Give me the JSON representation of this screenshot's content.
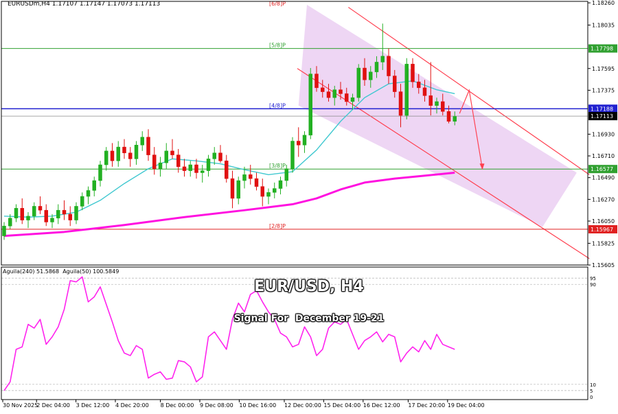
{
  "header": {
    "symbol_info": "EURUSDm,H4",
    "ohlc": "1.17107 1.17147 1.17073 1.17113"
  },
  "overlay": {
    "title": "EUR/USD, H4",
    "subtitle": "Signal For  December 19-21"
  },
  "colors": {
    "bull_candle": "#22b022",
    "bear_candle": "#e01010",
    "sma_fast": "#40c8d0",
    "sma_slow": "#ff10e0",
    "channel_line": "#ff4050",
    "channel_fill": "#e8c8f0",
    "murrey_green": "#30a030",
    "murrey_red": "#e02020",
    "price_blue": "#2020d0",
    "oscillator": "#ff22ee"
  },
  "chart_data": [
    {
      "type": "candlestick",
      "y_axis_ticks": [
        "1.18260",
        "1.18035",
        "1.17595",
        "1.17375",
        "1.16930",
        "1.16710",
        "1.16490",
        "1.16270",
        "1.16050",
        "1.15825",
        "1.15605"
      ],
      "ylim": [
        1.15605,
        1.18275
      ],
      "x_tick_labels": [
        "30 Nov 2025",
        "2 Dec 04:00",
        "3 Dec 12:00",
        "4 Dec 20:00",
        "8 Dec 00:00",
        "9 Dec 08:00",
        "10 Dec 16:00",
        "12 Dec 00:00",
        "15 Dec 04:00",
        "16 Dec 12:00",
        "17 Dec 20:00",
        "19 Dec 04:00"
      ],
      "murrey_levels": [
        {
          "label": "[6/8]P",
          "price": 1.18395,
          "color": "#e02020"
        },
        {
          "label": "[5/8]P",
          "price": 1.17798,
          "color": "#30a030"
        },
        {
          "label": "[4/8]P",
          "price": 1.17188,
          "color": "#2020d0"
        },
        {
          "label": "[3/8]P",
          "price": 1.16577,
          "color": "#30a030"
        },
        {
          "label": "[2/8]P",
          "price": 1.15967,
          "color": "#e02020"
        }
      ],
      "price_tags": [
        {
          "text": "1.17798",
          "price": 1.17798,
          "style": "green"
        },
        {
          "text": "1.17188",
          "price": 1.17188,
          "style": "blue"
        },
        {
          "text": "1.17113",
          "price": 1.17113,
          "style": "dark"
        },
        {
          "text": "1.16577",
          "price": 1.16577,
          "style": "green"
        },
        {
          "text": "1.15967",
          "price": 1.15967,
          "style": "red"
        }
      ],
      "current_price": 1.17113,
      "candles": [
        [
          1.159,
          1.1604,
          1.1586,
          1.16
        ],
        [
          1.16,
          1.1612,
          1.1597,
          1.1608
        ],
        [
          1.1608,
          1.1622,
          1.1604,
          1.1618
        ],
        [
          1.1618,
          1.1628,
          1.1602,
          1.1606
        ],
        [
          1.1606,
          1.1614,
          1.1598,
          1.161
        ],
        [
          1.161,
          1.1624,
          1.1606,
          1.162
        ],
        [
          1.162,
          1.163,
          1.1612,
          1.1616
        ],
        [
          1.1616,
          1.1622,
          1.16,
          1.1604
        ],
        [
          1.1604,
          1.1612,
          1.1598,
          1.1608
        ],
        [
          1.1608,
          1.1622,
          1.1602,
          1.1616
        ],
        [
          1.1616,
          1.1626,
          1.1606,
          1.1612
        ],
        [
          1.1612,
          1.162,
          1.16,
          1.1606
        ],
        [
          1.1606,
          1.1624,
          1.1602,
          1.162
        ],
        [
          1.162,
          1.1634,
          1.1616,
          1.163
        ],
        [
          1.163,
          1.164,
          1.1622,
          1.1636
        ],
        [
          1.1636,
          1.165,
          1.163,
          1.1646
        ],
        [
          1.1646,
          1.1666,
          1.164,
          1.1662
        ],
        [
          1.1662,
          1.168,
          1.1656,
          1.1676
        ],
        [
          1.1676,
          1.1684,
          1.166,
          1.1666
        ],
        [
          1.1666,
          1.1686,
          1.166,
          1.168
        ],
        [
          1.168,
          1.1688,
          1.1668,
          1.1674
        ],
        [
          1.1674,
          1.168,
          1.166,
          1.1668
        ],
        [
          1.1668,
          1.1686,
          1.1662,
          1.1682
        ],
        [
          1.1682,
          1.1696,
          1.1676,
          1.169
        ],
        [
          1.169,
          1.1698,
          1.1666,
          1.1672
        ],
        [
          1.1672,
          1.168,
          1.1652,
          1.1658
        ],
        [
          1.1658,
          1.167,
          1.165,
          1.1664
        ],
        [
          1.1664,
          1.1684,
          1.1658,
          1.1676
        ],
        [
          1.1676,
          1.1688,
          1.1668,
          1.1672
        ],
        [
          1.1672,
          1.1678,
          1.1654,
          1.166
        ],
        [
          1.166,
          1.1668,
          1.165,
          1.1656
        ],
        [
          1.1656,
          1.1666,
          1.165,
          1.1662
        ],
        [
          1.1662,
          1.1668,
          1.1648,
          1.1654
        ],
        [
          1.1654,
          1.1662,
          1.1644,
          1.1656
        ],
        [
          1.1656,
          1.1672,
          1.165,
          1.1668
        ],
        [
          1.1668,
          1.168,
          1.1662,
          1.1674
        ],
        [
          1.1674,
          1.1682,
          1.1664,
          1.1666
        ],
        [
          1.1666,
          1.1672,
          1.1644,
          1.1648
        ],
        [
          1.1648,
          1.1656,
          1.1618,
          1.1628
        ],
        [
          1.1628,
          1.165,
          1.1622,
          1.1646
        ],
        [
          1.1646,
          1.166,
          1.1638,
          1.1652
        ],
        [
          1.1652,
          1.1662,
          1.1642,
          1.1648
        ],
        [
          1.1648,
          1.1654,
          1.1636,
          1.164
        ],
        [
          1.164,
          1.1648,
          1.162,
          1.163
        ],
        [
          1.163,
          1.1638,
          1.1622,
          1.1634
        ],
        [
          1.1634,
          1.1644,
          1.1628,
          1.1638
        ],
        [
          1.1638,
          1.165,
          1.1632,
          1.1646
        ],
        [
          1.1646,
          1.1662,
          1.164,
          1.1658
        ],
        [
          1.1658,
          1.169,
          1.1654,
          1.1686
        ],
        [
          1.1686,
          1.17,
          1.167,
          1.1682
        ],
        [
          1.1682,
          1.1696,
          1.1674,
          1.1692
        ],
        [
          1.1692,
          1.176,
          1.1688,
          1.1754
        ],
        [
          1.1754,
          1.1762,
          1.1736,
          1.174
        ],
        [
          1.174,
          1.1748,
          1.173,
          1.1736
        ],
        [
          1.1736,
          1.1744,
          1.1726,
          1.173
        ],
        [
          1.173,
          1.1742,
          1.1722,
          1.1738
        ],
        [
          1.1738,
          1.1746,
          1.1728,
          1.1734
        ],
        [
          1.1734,
          1.174,
          1.1722,
          1.1726
        ],
        [
          1.1726,
          1.1734,
          1.1718,
          1.173
        ],
        [
          1.173,
          1.1764,
          1.1726,
          1.176
        ],
        [
          1.176,
          1.177,
          1.1742,
          1.1748
        ],
        [
          1.1748,
          1.1762,
          1.174,
          1.1756
        ],
        [
          1.1756,
          1.1772,
          1.175,
          1.1766
        ],
        [
          1.1766,
          1.1805,
          1.1758,
          1.1772
        ],
        [
          1.1772,
          1.178,
          1.1744,
          1.1752
        ],
        [
          1.1752,
          1.1758,
          1.173,
          1.1736
        ],
        [
          1.1736,
          1.1744,
          1.17,
          1.1712
        ],
        [
          1.1712,
          1.177,
          1.1708,
          1.1764
        ],
        [
          1.1764,
          1.177,
          1.174,
          1.1746
        ],
        [
          1.1746,
          1.1754,
          1.1734,
          1.174
        ],
        [
          1.174,
          1.1748,
          1.1726,
          1.1732
        ],
        [
          1.1732,
          1.1766,
          1.1712,
          1.1722
        ],
        [
          1.1722,
          1.173,
          1.1714,
          1.1726
        ],
        [
          1.1726,
          1.1734,
          1.1712,
          1.1716
        ],
        [
          1.1716,
          1.1722,
          1.1704,
          1.1706
        ],
        [
          1.1706,
          1.1716,
          1.1702,
          1.1711
        ]
      ],
      "sma_fast": [
        [
          0,
          1.161
        ],
        [
          4,
          1.1609
        ],
        [
          8,
          1.161
        ],
        [
          12,
          1.1614
        ],
        [
          16,
          1.1626
        ],
        [
          20,
          1.1643
        ],
        [
          24,
          1.1658
        ],
        [
          28,
          1.1668
        ],
        [
          32,
          1.1666
        ],
        [
          36,
          1.1663
        ],
        [
          40,
          1.1657
        ],
        [
          44,
          1.1652
        ],
        [
          48,
          1.1655
        ],
        [
          52,
          1.1677
        ],
        [
          56,
          1.1706
        ],
        [
          60,
          1.173
        ],
        [
          64,
          1.1744
        ],
        [
          68,
          1.1747
        ],
        [
          72,
          1.1738
        ],
        [
          75,
          1.1734
        ]
      ],
      "sma_slow": [
        [
          0,
          1.159
        ],
        [
          10,
          1.1594
        ],
        [
          20,
          1.1601
        ],
        [
          30,
          1.1609
        ],
        [
          40,
          1.1616
        ],
        [
          48,
          1.1622
        ],
        [
          52,
          1.1628
        ],
        [
          56,
          1.1637
        ],
        [
          60,
          1.1644
        ],
        [
          65,
          1.1648
        ],
        [
          70,
          1.1651
        ],
        [
          75,
          1.1654
        ]
      ]
    },
    {
      "type": "line",
      "legend": "Aguila(240) 51.5868  Aguila(50) 100.5849",
      "ylim": [
        0,
        100
      ],
      "levels": [
        95,
        90,
        10,
        5
      ],
      "tick_labels": [
        "95",
        "90",
        "10",
        "5",
        "0"
      ],
      "values": [
        5,
        12,
        38,
        40,
        58,
        55,
        62,
        42,
        48,
        56,
        70,
        93,
        92,
        96,
        76,
        80,
        88,
        74,
        60,
        45,
        35,
        33,
        41,
        38,
        15,
        18,
        20,
        14,
        15,
        29,
        28,
        24,
        12,
        16,
        48,
        52,
        45,
        38,
        62,
        75,
        68,
        82,
        85,
        76,
        68,
        62,
        51,
        48,
        40,
        42,
        56,
        48,
        33,
        38,
        55,
        60,
        58,
        62,
        50,
        38,
        45,
        48,
        52,
        44,
        50,
        48,
        28,
        35,
        40,
        36,
        45,
        38,
        50,
        42,
        40,
        38
      ]
    }
  ]
}
